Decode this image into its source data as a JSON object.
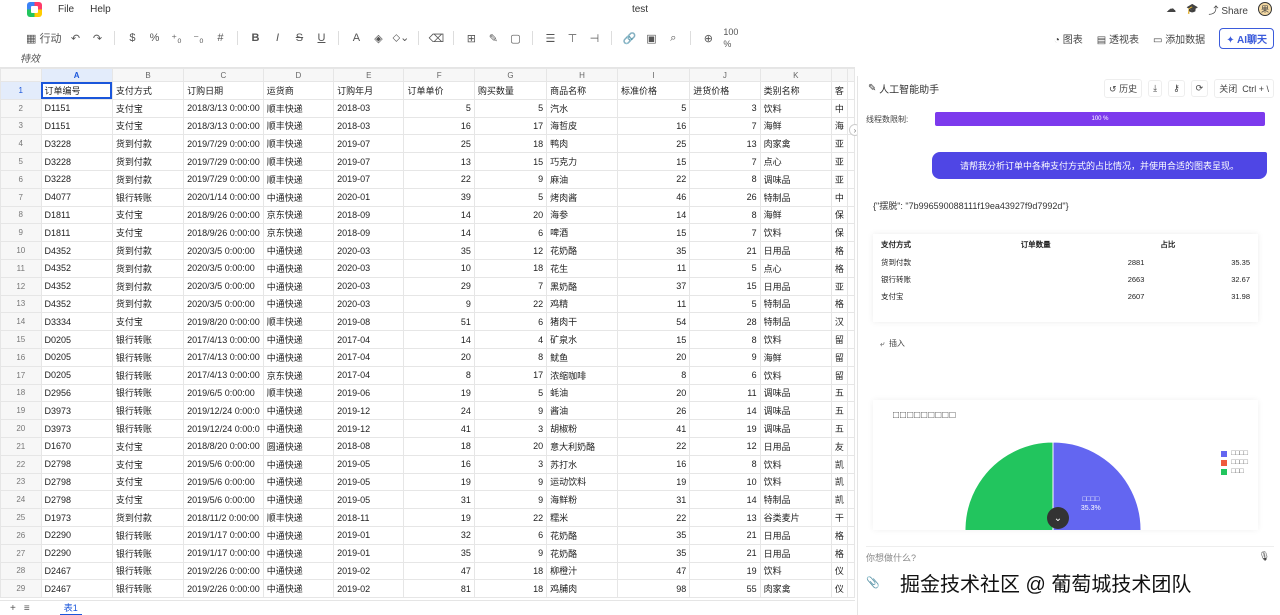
{
  "app": {
    "title": "test",
    "menu": [
      "File",
      "Help"
    ],
    "share_label": "Share",
    "avatar_text": "果"
  },
  "toolbar": {
    "view_label": "行动",
    "zoom": "100",
    "zoom_unit": "%",
    "pivot_chart": "图表",
    "pivot_table": "透视表",
    "add_data": "添加数据",
    "ai_chat": "AI聊天"
  },
  "formula": {
    "text": "特效"
  },
  "grid": {
    "col_letters": [
      "A",
      "B",
      "C",
      "D",
      "E",
      "F",
      "G",
      "H",
      "I",
      "J",
      "K"
    ],
    "headers": [
      "订单编号",
      "支付方式",
      "订购日期",
      "运货商",
      "订购年月",
      "订单单价",
      "购买数量",
      "商品名称",
      "标准价格",
      "进货价格",
      "类别名称"
    ],
    "rows": [
      [
        "D1151",
        "支付宝",
        "2018/3/13 0:00:00",
        "顺丰快递",
        "2018-03",
        "5",
        "5",
        "汽水",
        "5",
        "3",
        "饮料"
      ],
      [
        "D1151",
        "支付宝",
        "2018/3/13 0:00:00",
        "顺丰快递",
        "2018-03",
        "16",
        "17",
        "海哲皮",
        "16",
        "7",
        "海鲜"
      ],
      [
        "D3228",
        "货到付款",
        "2019/7/29 0:00:00",
        "顺丰快递",
        "2019-07",
        "25",
        "18",
        "鸭肉",
        "25",
        "13",
        "肉家禽"
      ],
      [
        "D3228",
        "货到付款",
        "2019/7/29 0:00:00",
        "顺丰快递",
        "2019-07",
        "13",
        "15",
        "巧克力",
        "15",
        "7",
        "点心"
      ],
      [
        "D3228",
        "货到付款",
        "2019/7/29 0:00:00",
        "顺丰快递",
        "2019-07",
        "22",
        "9",
        "麻油",
        "22",
        "8",
        "调味品"
      ],
      [
        "D4077",
        "银行转账",
        "2020/1/14 0:00:00",
        "中通快递",
        "2020-01",
        "39",
        "5",
        "烤肉酱",
        "46",
        "26",
        "特制品"
      ],
      [
        "D1811",
        "支付宝",
        "2018/9/26 0:00:00",
        "京东快递",
        "2018-09",
        "14",
        "20",
        "海参",
        "14",
        "8",
        "海鲜"
      ],
      [
        "D1811",
        "支付宝",
        "2018/9/26 0:00:00",
        "京东快递",
        "2018-09",
        "14",
        "6",
        "啤酒",
        "15",
        "7",
        "饮料"
      ],
      [
        "D4352",
        "货到付款",
        "2020/3/5 0:00:00",
        "中通快递",
        "2020-03",
        "35",
        "12",
        "花奶酪",
        "35",
        "21",
        "日用品"
      ],
      [
        "D4352",
        "货到付款",
        "2020/3/5 0:00:00",
        "中通快递",
        "2020-03",
        "10",
        "18",
        "花生",
        "11",
        "5",
        "点心"
      ],
      [
        "D4352",
        "货到付款",
        "2020/3/5 0:00:00",
        "中通快递",
        "2020-03",
        "29",
        "7",
        "黑奶酪",
        "37",
        "15",
        "日用品"
      ],
      [
        "D4352",
        "货到付款",
        "2020/3/5 0:00:00",
        "中通快递",
        "2020-03",
        "9",
        "22",
        "鸡精",
        "11",
        "5",
        "特制品"
      ],
      [
        "D3334",
        "支付宝",
        "2019/8/20 0:00:00",
        "顺丰快递",
        "2019-08",
        "51",
        "6",
        "猪肉干",
        "54",
        "28",
        "特制品"
      ],
      [
        "D0205",
        "银行转账",
        "2017/4/13 0:00:00",
        "中通快递",
        "2017-04",
        "14",
        "4",
        "矿泉水",
        "15",
        "8",
        "饮料"
      ],
      [
        "D0205",
        "银行转账",
        "2017/4/13 0:00:00",
        "中通快递",
        "2017-04",
        "20",
        "8",
        "鱿鱼",
        "20",
        "9",
        "海鲜"
      ],
      [
        "D0205",
        "银行转账",
        "2017/4/13 0:00:00",
        "京东快递",
        "2017-04",
        "8",
        "17",
        "浓缩咖啡",
        "8",
        "6",
        "饮料"
      ],
      [
        "D2956",
        "银行转账",
        "2019/6/5 0:00:00",
        "顺丰快递",
        "2019-06",
        "19",
        "5",
        "蚝油",
        "20",
        "11",
        "调味品"
      ],
      [
        "D3973",
        "银行转账",
        "2019/12/24 0:00:0",
        "中通快递",
        "2019-12",
        "24",
        "9",
        "酱油",
        "26",
        "14",
        "调味品"
      ],
      [
        "D3973",
        "银行转账",
        "2019/12/24 0:00:0",
        "中通快递",
        "2019-12",
        "41",
        "3",
        "胡椒粉",
        "41",
        "19",
        "调味品"
      ],
      [
        "D1670",
        "支付宝",
        "2018/8/20 0:00:00",
        "圆通快递",
        "2018-08",
        "18",
        "20",
        "意大利奶酪",
        "22",
        "12",
        "日用品"
      ],
      [
        "D2798",
        "支付宝",
        "2019/5/6 0:00:00",
        "中通快递",
        "2019-05",
        "16",
        "3",
        "苏打水",
        "16",
        "8",
        "饮料"
      ],
      [
        "D2798",
        "支付宝",
        "2019/5/6 0:00:00",
        "中通快递",
        "2019-05",
        "19",
        "9",
        "运动饮料",
        "19",
        "10",
        "饮料"
      ],
      [
        "D2798",
        "支付宝",
        "2019/5/6 0:00:00",
        "中通快递",
        "2019-05",
        "31",
        "9",
        "海鲜粉",
        "31",
        "14",
        "特制品"
      ],
      [
        "D1973",
        "货到付款",
        "2018/11/2 0:00:00",
        "顺丰快递",
        "2018-11",
        "19",
        "22",
        "糯米",
        "22",
        "13",
        "谷类麦片"
      ],
      [
        "D2290",
        "银行转账",
        "2019/1/17 0:00:00",
        "中通快递",
        "2019-01",
        "32",
        "6",
        "花奶酪",
        "35",
        "21",
        "日用品"
      ],
      [
        "D2290",
        "银行转账",
        "2019/1/17 0:00:00",
        "中通快递",
        "2019-01",
        "35",
        "9",
        "花奶酪",
        "35",
        "21",
        "日用品"
      ],
      [
        "D2467",
        "银行转账",
        "2019/2/26 0:00:00",
        "中通快递",
        "2019-02",
        "47",
        "18",
        "柳橙汁",
        "47",
        "19",
        "饮料"
      ],
      [
        "D2467",
        "银行转账",
        "2019/2/26 0:00:00",
        "中通快递",
        "2019-02",
        "81",
        "18",
        "鸡脯肉",
        "98",
        "55",
        "肉家禽"
      ]
    ],
    "next_col_partial": [
      "中",
      "海",
      "亚",
      "亚",
      "亚",
      "中",
      "保",
      "保",
      "格",
      "格",
      "亚",
      "格",
      "汉",
      "留",
      "留",
      "留",
      "五",
      "五",
      "五",
      "友",
      "凯",
      "凯",
      "凯",
      "干",
      "格",
      "格",
      "仪",
      "仪"
    ]
  },
  "sheet": {
    "tab_label": "表1"
  },
  "ai_panel": {
    "title": "人工智能助手",
    "history_label": "历史",
    "close_label": "关闭",
    "shortcut": "Ctrl + \\",
    "limit_label": "线程数限制:",
    "limit_value": "100 %",
    "limit_fraction": 1.0,
    "user_message": "请帮我分析订单中各种支付方式的占比情况，并使用合适的图表呈现。",
    "ai_json": "{\"摆脱\": \"7b996590088111f19ea43927f9d7992d\"}",
    "result_table": {
      "headers": [
        "支付方式",
        "订单数量",
        "占比"
      ],
      "rows": [
        [
          "货到付款",
          "2881",
          "35.35"
        ],
        [
          "银行转账",
          "2663",
          "32.67"
        ],
        [
          "支付宝",
          "2607",
          "31.98"
        ]
      ]
    },
    "insert_label": "插入",
    "chart_title": "□□□□□□□□□",
    "input_placeholder": "你想做什么?",
    "watermark": "掘金技术社区 @ 葡萄城技术团队"
  },
  "chart_data": {
    "type": "pie",
    "title": "□□□□□□□□□",
    "categories": [
      "□□□□",
      "□□□□",
      "□□□"
    ],
    "values": [
      35.3,
      32.7,
      32.0
    ],
    "slice_labels": [
      "□□□□\n35.3%",
      "□□□□\n32.7%",
      ""
    ],
    "colors": [
      "#6366f1",
      "#ef5a3c",
      "#22c55e"
    ],
    "legend": "right"
  }
}
